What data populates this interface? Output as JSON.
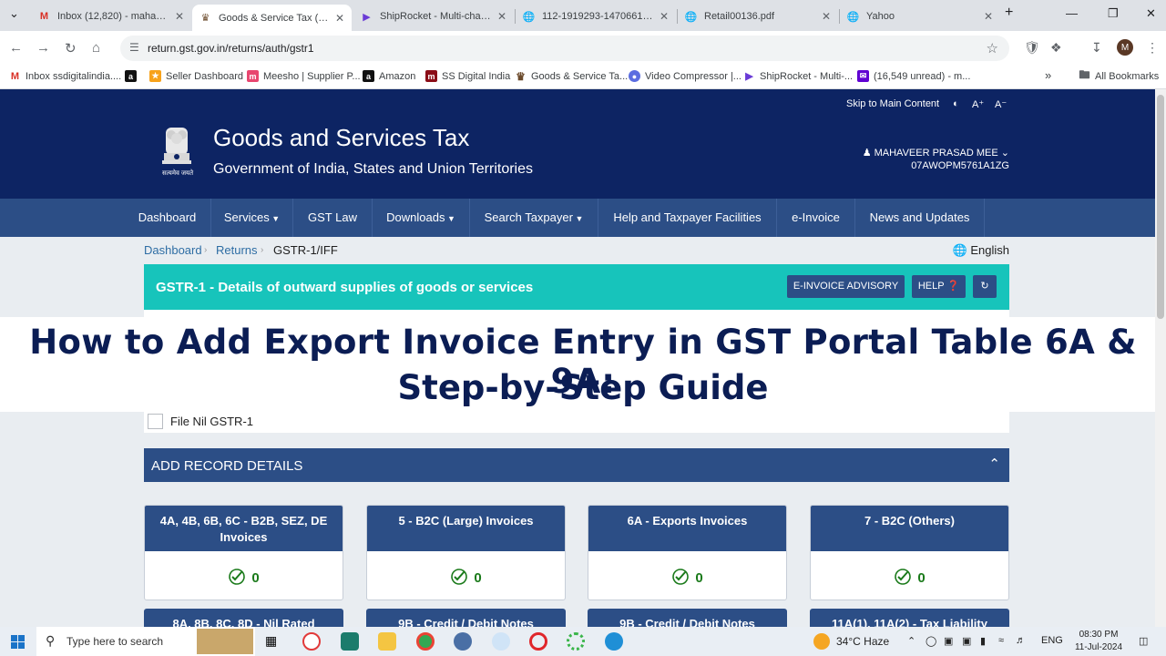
{
  "browser": {
    "tabs": [
      {
        "title": "Inbox (12,820) - mahaveer",
        "icon": "gmail-icon",
        "active": false
      },
      {
        "title": "Goods & Service Tax (GST)",
        "icon": "gst-icon",
        "active": true
      },
      {
        "title": "ShipRocket - Multi-channe",
        "icon": "shiprocket-icon",
        "active": false
      },
      {
        "title": "112-1919293-1470661 (1).p",
        "icon": "globe-icon",
        "active": false
      },
      {
        "title": "Retail00136.pdf",
        "icon": "globe-icon",
        "active": false
      },
      {
        "title": "Yahoo",
        "icon": "globe-icon",
        "active": false
      }
    ],
    "url": "return.gst.gov.in/returns/auth/gstr1",
    "profile_initial": "M",
    "bookmarks": [
      {
        "label": "Inbox ssdigitalindia....",
        "icon": "gmail-icon"
      },
      {
        "label": "",
        "icon": "amazon-icon"
      },
      {
        "label": "Seller Dashboard",
        "icon": "seller-icon"
      },
      {
        "label": "Meesho | Supplier P...",
        "icon": "meesho-icon"
      },
      {
        "label": "Amazon",
        "icon": "amazon-icon"
      },
      {
        "label": "SS Digital India",
        "icon": "ss-icon"
      },
      {
        "label": "Goods & Service Ta...",
        "icon": "gst-icon"
      },
      {
        "label": "Video Compressor |...",
        "icon": "video-icon"
      },
      {
        "label": "ShipRocket - Multi-...",
        "icon": "shiprocket-icon"
      },
      {
        "label": "(16,549 unread) - m...",
        "icon": "mail-icon"
      }
    ],
    "all_bookmarks": "All Bookmarks"
  },
  "gst": {
    "skip": "Skip to Main Content",
    "font_up": "A⁺",
    "font_down": "A⁻",
    "title": "Goods and Services Tax",
    "subtitle": "Government of India, States and Union Territories",
    "emblem_text": "सत्यमेव जयते",
    "user_name": "MAHAVEER PRASAD MEE",
    "gstin": "07AWOPM5761A1ZG",
    "nav": [
      {
        "label": "Dashboard",
        "dropdown": false
      },
      {
        "label": "Services",
        "dropdown": true
      },
      {
        "label": "GST Law",
        "dropdown": false
      },
      {
        "label": "Downloads",
        "dropdown": true
      },
      {
        "label": "Search Taxpayer",
        "dropdown": true
      },
      {
        "label": "Help and Taxpayer Facilities",
        "dropdown": false
      },
      {
        "label": "e-Invoice",
        "dropdown": false
      },
      {
        "label": "News and Updates",
        "dropdown": false
      }
    ],
    "breadcrumb": [
      "Dashboard",
      "Returns",
      "GSTR-1/IFF"
    ],
    "language": "English",
    "panel_title": "GSTR-1 - Details of outward supplies of goods or services",
    "einvoice_btn": "E-INVOICE ADVISORY",
    "help_btn": "HELP",
    "overlay_line1": "How to Add Export Invoice Entry in GST Portal Table 6A & 9A:",
    "overlay_line2": "Step-by-Step Guide",
    "nil_label": "File Nil GSTR-1",
    "add_record": "ADD RECORD DETAILS",
    "cards": [
      {
        "title": "4A, 4B, 6B, 6C - B2B, SEZ, DE Invoices",
        "count": "0"
      },
      {
        "title": "5 - B2C (Large) Invoices",
        "count": "0"
      },
      {
        "title": "6A - Exports Invoices",
        "count": "0"
      },
      {
        "title": "7 - B2C (Others)",
        "count": "0"
      }
    ],
    "cards_row2": [
      {
        "title": "8A, 8B, 8C, 8D - Nil Rated"
      },
      {
        "title": "9B - Credit / Debit Notes"
      },
      {
        "title": "9B - Credit / Debit Notes"
      },
      {
        "title": "11A(1), 11A(2) - Tax Liability"
      }
    ]
  },
  "taskbar": {
    "search_placeholder": "Type here to search",
    "weather": "34°C  Haze",
    "lang": "ENG",
    "time": "08:30 PM",
    "date": "11-Jul-2024"
  },
  "colors": {
    "header_bg": "#0d2463",
    "nav_bg": "#2c4e86",
    "panel_teal": "#17c4bb",
    "count_green": "#1a7a1a"
  }
}
